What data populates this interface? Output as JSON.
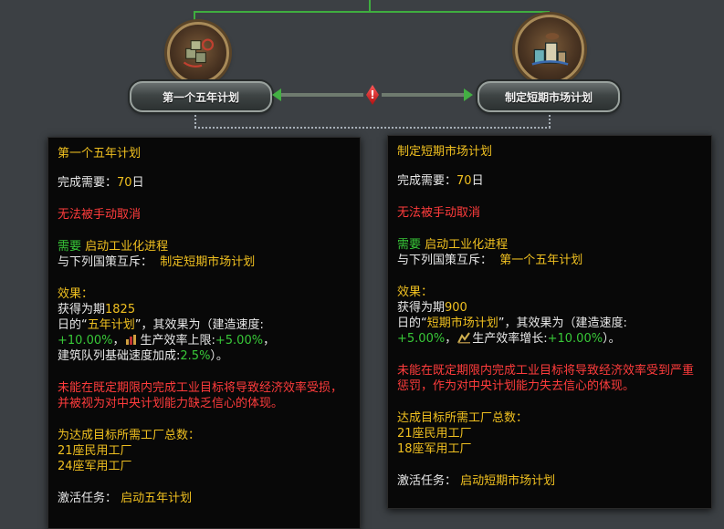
{
  "focuses": {
    "left": {
      "name": "第一个五年计划"
    },
    "right": {
      "name": "制定短期市场计划"
    }
  },
  "tooltip_left": {
    "title": "第一个五年计划",
    "complete_label": "完成需要：",
    "complete_value": "70",
    "complete_unit": "日",
    "cannot_cancel": "无法被手动取消",
    "requires_label": "需要 ",
    "requires_value": "启动工业化进程",
    "exclusive_label": "与下列国策互斥：",
    "exclusive_value": "制定短期市场计划",
    "effects_label": "效果：",
    "gain_prefix": "获得为期",
    "gain_days": "1825",
    "line2_prefix": "日的“",
    "idea_name": "五年计划",
    "line2_suffix": "”，其效果为（建造速度:",
    "build_speed": "+10.00%",
    "sep1": "，",
    "effect2_label": "生产效率上限:",
    "effect2_value": "+5.00%",
    "sep2": "，",
    "line4_label": "建筑队列基础速度加成:",
    "line4_value": "2.5%",
    "line4_suffix": "）。",
    "warning": "未能在既定期限内完成工业目标将导致经济效率受损，并被视为对中央计划能力缺乏信心的体现。",
    "factories_label": "为达成目标所需工厂总数：",
    "civ_factories": "21座民用工厂",
    "mil_factories": "24座军用工厂",
    "mission_label": "激活任务：",
    "mission_value": "启动五年计划"
  },
  "tooltip_right": {
    "title": "制定短期市场计划",
    "complete_label": "完成需要：",
    "complete_value": "70",
    "complete_unit": "日",
    "cannot_cancel": "无法被手动取消",
    "requires_label": "需要 ",
    "requires_value": "启动工业化进程",
    "exclusive_label": "与下列国策互斥：",
    "exclusive_value": "第一个五年计划",
    "effects_label": "效果：",
    "gain_prefix": "获得为期",
    "gain_days": "900",
    "line2_prefix": "日的“",
    "idea_name": "短期市场计划",
    "line2_suffix": "”，其效果为（建造速度:",
    "build_speed": "+5.00%",
    "sep1": "，",
    "effect2_label": "生产效率增长:",
    "effect2_value": "+10.00%",
    "line3_suffix": "）。",
    "warning": "未能在既定期限内完成工业目标将导致经济效率受到严重惩罚，作为对中央计划能力失去信心的体现。",
    "factories_label": "达成目标所需工厂总数：",
    "civ_factories": "21座民用工厂",
    "mil_factories": "18座军用工厂",
    "mission_label": "激活任务：",
    "mission_value": "启动短期市场计划"
  }
}
